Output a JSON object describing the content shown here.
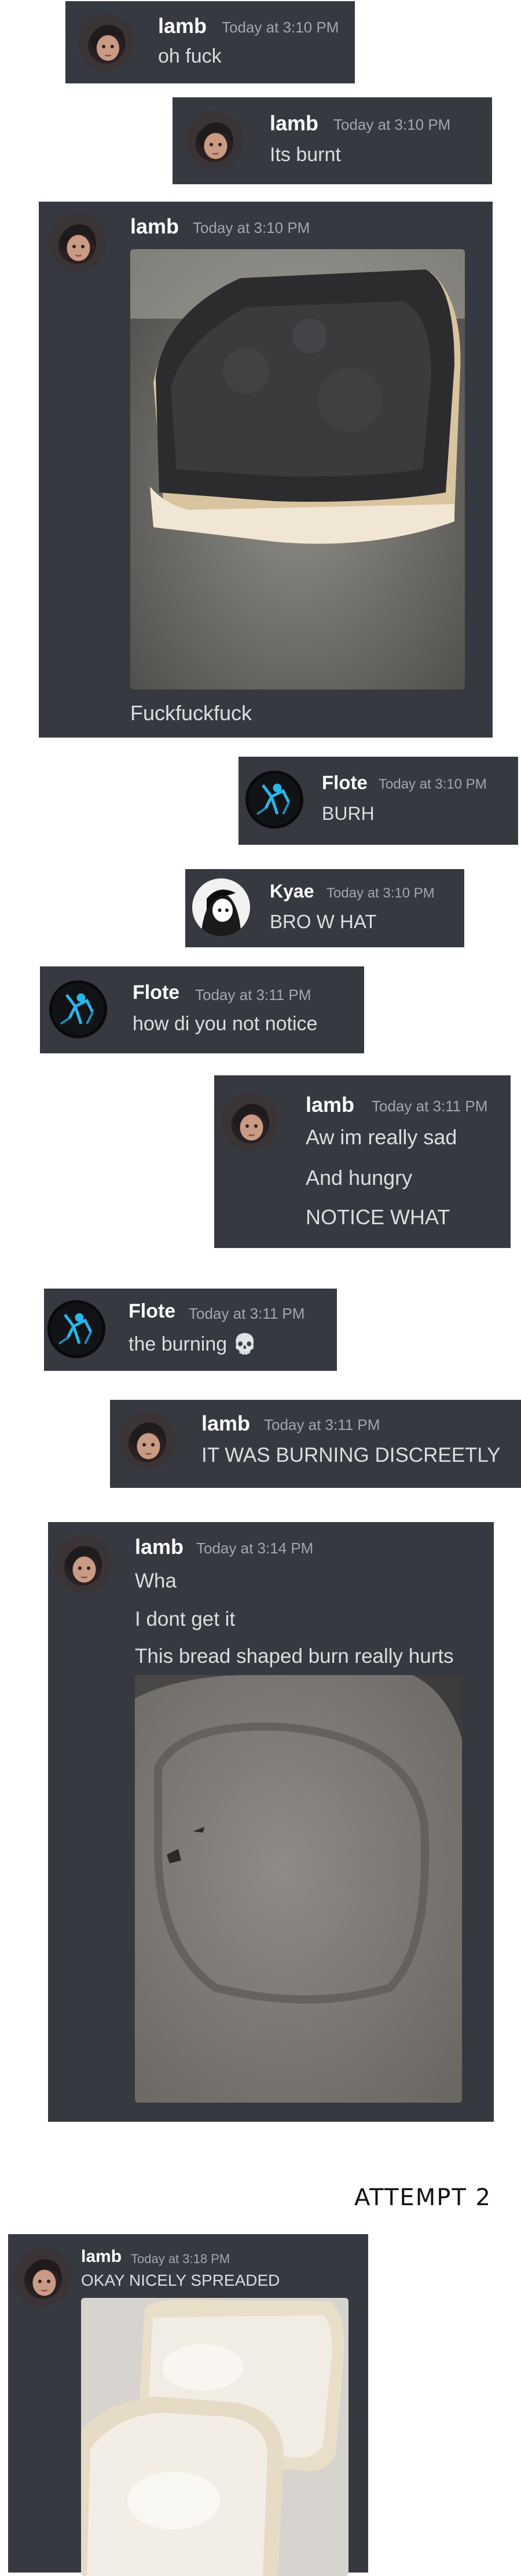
{
  "messages": [
    {
      "author": "lamb",
      "time": "Today at 3:10 PM",
      "lines": [
        "oh fuck"
      ]
    },
    {
      "author": "lamb",
      "time": "Today at 3:10 PM",
      "lines": [
        "Its burnt"
      ]
    },
    {
      "author": "lamb",
      "time": "Today at 3:10 PM",
      "lines": [
        "Fuckfuckfuck"
      ],
      "image": "burnt-toast"
    },
    {
      "author": "Flote",
      "time": "Today at 3:10 PM",
      "lines": [
        "BURH"
      ]
    },
    {
      "author": "Kyae",
      "time": "Today at 3:10 PM",
      "lines": [
        "BRO W HAT"
      ]
    },
    {
      "author": "Flote",
      "time": "Today at 3:11 PM",
      "lines": [
        "how di you not notice"
      ]
    },
    {
      "author": "lamb",
      "time": "Today at 3:11 PM",
      "lines": [
        "Aw im really sad",
        "And hungry",
        "NOTICE WHAT"
      ]
    },
    {
      "author": "Flote",
      "time": "Today at 3:11 PM",
      "lines": [
        "the burning 💀"
      ]
    },
    {
      "author": "lamb",
      "time": "Today at 3:11 PM",
      "lines": [
        "IT WAS BURNING DISCREETLY"
      ]
    },
    {
      "author": "lamb",
      "time": "Today at 3:14 PM",
      "lines": [
        "Wha",
        "I dont get it",
        "This bread shaped burn really hurts"
      ],
      "image": "burn-mark-pan"
    },
    {
      "author": "lamb",
      "time": "Today at 3:18 PM",
      "lines": [
        "OKAY NICELY SPREADED"
      ],
      "image": "buttered-bread"
    }
  ],
  "caption": "ATTEMPT 2",
  "colors": {
    "panel": "#36393f",
    "text": "#dcddde",
    "name": "#ffffff",
    "timestamp": "#a3a6aa",
    "page": "#ffffff"
  },
  "icons": {
    "lamb": "avatar-lamb-icon",
    "Flote": "avatar-flote-icon",
    "Kyae": "avatar-kyae-icon"
  }
}
